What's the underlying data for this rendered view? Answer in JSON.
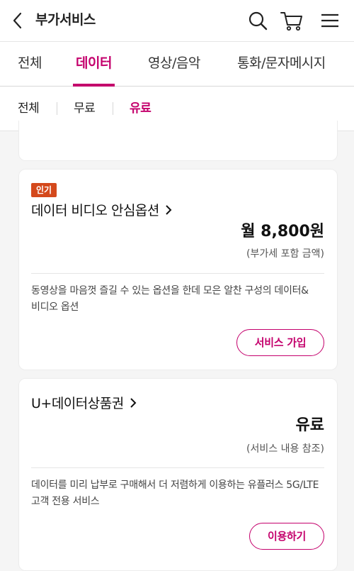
{
  "header": {
    "title": "부가서비스",
    "back_icon": "chevron-left-icon",
    "search_icon": "search-icon",
    "cart_icon": "cart-icon",
    "menu_icon": "menu-icon"
  },
  "tabs": [
    {
      "label": "전체",
      "active": false
    },
    {
      "label": "데이터",
      "active": true
    },
    {
      "label": "영상/음악",
      "active": false
    },
    {
      "label": "통화/문자메시지",
      "active": false
    }
  ],
  "subtabs": [
    {
      "label": "전체",
      "active": false
    },
    {
      "label": "무료",
      "active": false
    },
    {
      "label": "유료",
      "active": true
    }
  ],
  "cards": [
    {
      "badge": "인기",
      "name": "데이터 비디오 안심옵션",
      "price": "월 8,800원",
      "price_note": "(부가세 포함 금액)",
      "desc_line1": "동영상을 마음껏 즐길 수 있는 옵션을 한데 모은 알찬 구성의 데이터&",
      "desc_line2": "비디오 옵션",
      "button": "서비스 가입"
    },
    {
      "name": "U+데이터상품권",
      "price": "유료",
      "price_note": "(서비스 내용 참조)",
      "desc_line1": "데이터를 미리 납부로 구매해서 더 저렴하게 이용하는 유플러스 5G/LTE",
      "desc_line2": "고객 전용 서비스",
      "button": "이용하기"
    }
  ],
  "colors": {
    "accent": "#c4006c",
    "badge": "#d4491c"
  }
}
